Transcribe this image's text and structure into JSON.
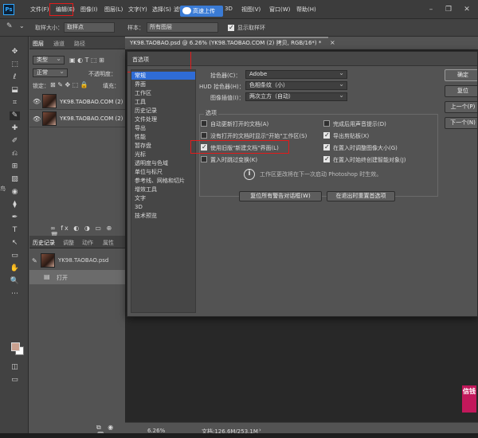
{
  "menubar": {
    "logo": "Ps",
    "items": [
      "文件(F)",
      "编辑(E)",
      "图像(I)",
      "图层(L)",
      "文字(Y)",
      "选择(S)",
      "滤镜",
      "3D",
      "视图(V)",
      "窗口(W)",
      "帮助(H)"
    ],
    "cloud_badge": "高速上传",
    "window_controls": [
      "–",
      "❐",
      "✕"
    ]
  },
  "optionsbar": {
    "sample_size_label": "取样大小：",
    "sample_size_value": "取样点",
    "sample_label": "样本：",
    "sample_value": "所有图层",
    "show_ring_label": "显示取样环"
  },
  "tools": [
    "✥",
    "⬚",
    "ℓ",
    "⬓",
    "⌗",
    "✎",
    "✚",
    "✐",
    "⎌",
    "⊞",
    "▨",
    "◉",
    "⧫",
    "✒",
    "T",
    "↖",
    "▭",
    "✋",
    "🔍",
    "⋯"
  ],
  "layers_panel": {
    "tabs": [
      "图层",
      "通道",
      "路径"
    ],
    "kind_label": "类型",
    "blend_mode": "正常",
    "opacity_label": "不透明度：",
    "lock_label": "锁定：",
    "fill_label": "填充：",
    "layers": [
      {
        "name": "YK98.TAOBAO.COM (2) 拷贝",
        "visible": true,
        "selected": false
      },
      {
        "name": "YK98.TAOBAO.COM (2)",
        "visible": true,
        "selected": false
      }
    ]
  },
  "history_panel": {
    "tabs": [
      "历史记录",
      "调整",
      "动作",
      "属性"
    ],
    "snapshot": "YK98.TAOBAO.psd",
    "steps": [
      "打开"
    ]
  },
  "document": {
    "tab_title": "YK98.TAOBAO.psd @ 6.26% (YK98.TAOBAO.COM (2) 拷贝, RGB/16*) *",
    "zoom": "6.26%",
    "doc_size": "文档:126.6M/253.1M"
  },
  "preferences": {
    "title": "首选项",
    "categories": [
      "常规",
      "界面",
      "工作区",
      "工具",
      "历史记录",
      "文件处理",
      "导出",
      "性能",
      "暂存盘",
      "光标",
      "透明度与色域",
      "单位与标尺",
      "参考线、网格和切片",
      "增效工具",
      "文字",
      "3D",
      "技术预览"
    ],
    "selected_category": 0,
    "color_picker_label": "拾色器(C)：",
    "color_picker_value": "Adobe",
    "hud_picker_label": "HUD 拾色器(H)：",
    "hud_picker_value": "色相条纹（小）",
    "interp_label": "图像插值(I)：",
    "interp_value": "两次立方（自动）",
    "options_legend": "选项",
    "options": [
      {
        "label": "自动更新打开的文档(A)",
        "checked": false
      },
      {
        "label": "完成后用声音提示(D)",
        "checked": false
      },
      {
        "label": "没有打开的文档时显示\"开始\"工作区(S)",
        "checked": false
      },
      {
        "label": "导出剪贴板(X)",
        "checked": true
      },
      {
        "label": "使用旧版\"新建文档\"界面(L)",
        "checked": true
      },
      {
        "label": "在置入时调整图像大小(G)",
        "checked": true
      },
      {
        "label": "置入时跳过变换(K)",
        "checked": false
      },
      {
        "label": "在置入时始终创建智能对象(J)",
        "checked": true
      }
    ],
    "info_text": "工作区更改将在下一次启动 Photoshop 时生效。",
    "reset_warnings_button": "复位所有警告对话框(W)",
    "reset_on_quit_button": "在退出时重置首选项",
    "side_buttons": [
      "确定",
      "复位",
      "上一个(P)",
      "下一个(N)"
    ]
  },
  "overlays": {
    "left_edge_text": "鸟",
    "right_badge": "信钱"
  }
}
